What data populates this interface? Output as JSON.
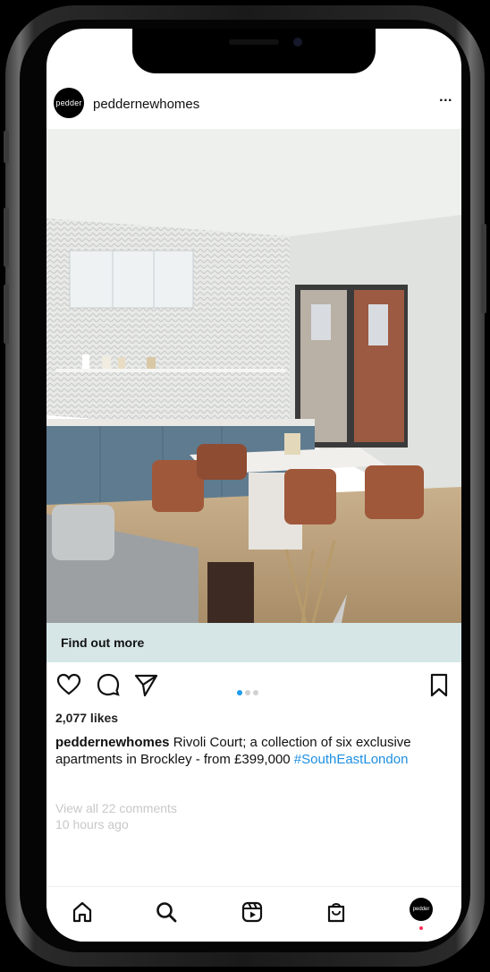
{
  "post": {
    "avatar_text": "pedder",
    "username": "peddernewhomes",
    "more_label": "...",
    "cta_label": "Find out more",
    "likes": "2,077 likes",
    "caption_user": "peddernewhomes",
    "caption_text": " Rivoli Court; a collection of six exclusive apartments in Brockley - from £399,000 ",
    "hashtag": "#SouthEastLondon",
    "view_comments": "View all 22 comments",
    "time_ago": "10 hours ago",
    "carousel": {
      "total": 3,
      "active": 1
    }
  },
  "nav": {
    "avatar_text": "pedder",
    "items": [
      "home-icon",
      "search-icon",
      "reels-icon",
      "shop-icon",
      "profile-avatar"
    ]
  },
  "colors": {
    "cta_bg": "#d6e6e7",
    "hashtag": "#1d8fe0",
    "active_dot": "#1d9bf0",
    "notification": "#ff2d55"
  }
}
